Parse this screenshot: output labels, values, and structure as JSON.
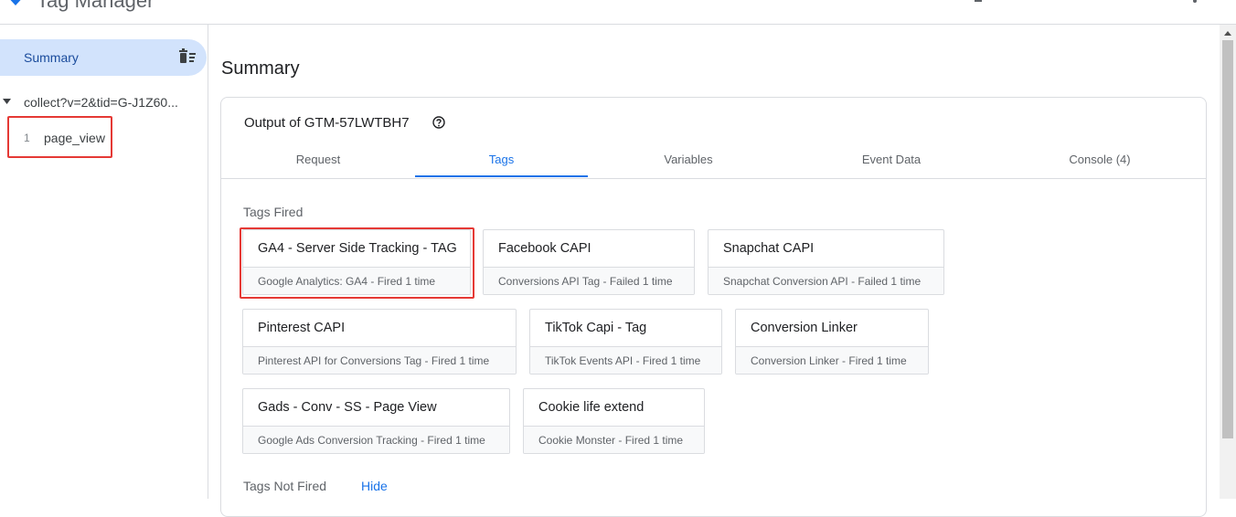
{
  "app": {
    "title": "Tag Manager"
  },
  "sidebar": {
    "summary_label": "Summary",
    "request_label": "collect?v=2&tid=G-J1Z60...",
    "events": [
      {
        "number": "1",
        "name": "page_view"
      }
    ]
  },
  "main": {
    "page_title": "Summary",
    "card_title": "Output of GTM-57LWTBH7",
    "tabs": [
      {
        "label": "Request"
      },
      {
        "label": "Tags",
        "active": true
      },
      {
        "label": "Variables"
      },
      {
        "label": "Event Data"
      },
      {
        "label": "Console (4)"
      }
    ],
    "tags_fired_label": "Tags Fired",
    "tags_fired": [
      {
        "name": "GA4 - Server Side Tracking - TAG",
        "meta": "Google Analytics: GA4 - Fired 1 time"
      },
      {
        "name": "Facebook CAPI",
        "meta": "Conversions API Tag - Failed 1 time"
      },
      {
        "name": "Snapchat CAPI",
        "meta": "Snapchat Conversion API - Failed 1 time"
      },
      {
        "name": "Pinterest CAPI",
        "meta": "Pinterest API for Conversions Tag - Fired 1 time"
      },
      {
        "name": "TikTok Capi - Tag",
        "meta": "TikTok Events API - Fired 1 time"
      },
      {
        "name": "Conversion Linker",
        "meta": "Conversion Linker - Fired 1 time"
      },
      {
        "name": "Gads - Conv - SS - Page View",
        "meta": "Google Ads Conversion Tracking - Fired 1 time"
      },
      {
        "name": "Cookie life extend",
        "meta": "Cookie Monster - Fired 1 time"
      }
    ],
    "tags_not_fired_label": "Tags Not Fired",
    "hide_label": "Hide"
  },
  "colors": {
    "accent": "#1a73e8",
    "selected_bg": "#d2e3fc",
    "highlight_border": "#e53935"
  }
}
